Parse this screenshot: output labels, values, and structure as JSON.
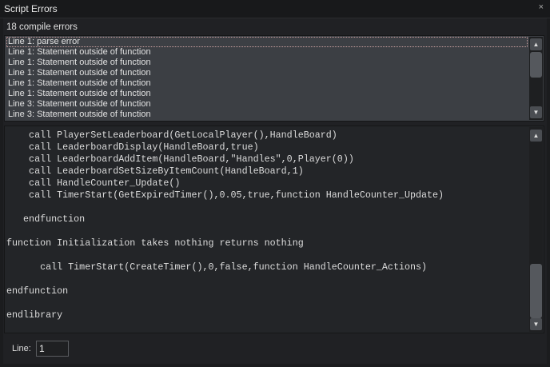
{
  "window": {
    "title": "Script Errors",
    "close_label": "×"
  },
  "summary": "18 compile errors",
  "errors": [
    "Line 1: parse error",
    "Line 1: Statement outside of function",
    "Line 1: Statement outside of function",
    "Line 1: Statement outside of function",
    "Line 1: Statement outside of function",
    "Line 1: Statement outside of function",
    "Line 3: Statement outside of function",
    "Line 3: Statement outside of function"
  ],
  "scroll": {
    "up": "▲",
    "down": "▼"
  },
  "code_lines": [
    "    call PlayerSetLeaderboard(GetLocalPlayer(),HandleBoard)",
    "    call LeaderboardDisplay(HandleBoard,true)",
    "    call LeaderboardAddItem(HandleBoard,\"Handles\",0,Player(0))",
    "    call LeaderboardSetSizeByItemCount(HandleBoard,1)",
    "    call HandleCounter_Update()",
    "    call TimerStart(GetExpiredTimer(),0.05,true,function HandleCounter_Update)",
    "",
    "   endfunction",
    "",
    "function Initialization takes nothing returns nothing",
    "",
    "      call TimerStart(CreateTimer(),0,false,function HandleCounter_Actions)",
    "",
    "endfunction",
    "",
    "endlibrary"
  ],
  "goto": {
    "label": "Line:",
    "value": "1"
  }
}
